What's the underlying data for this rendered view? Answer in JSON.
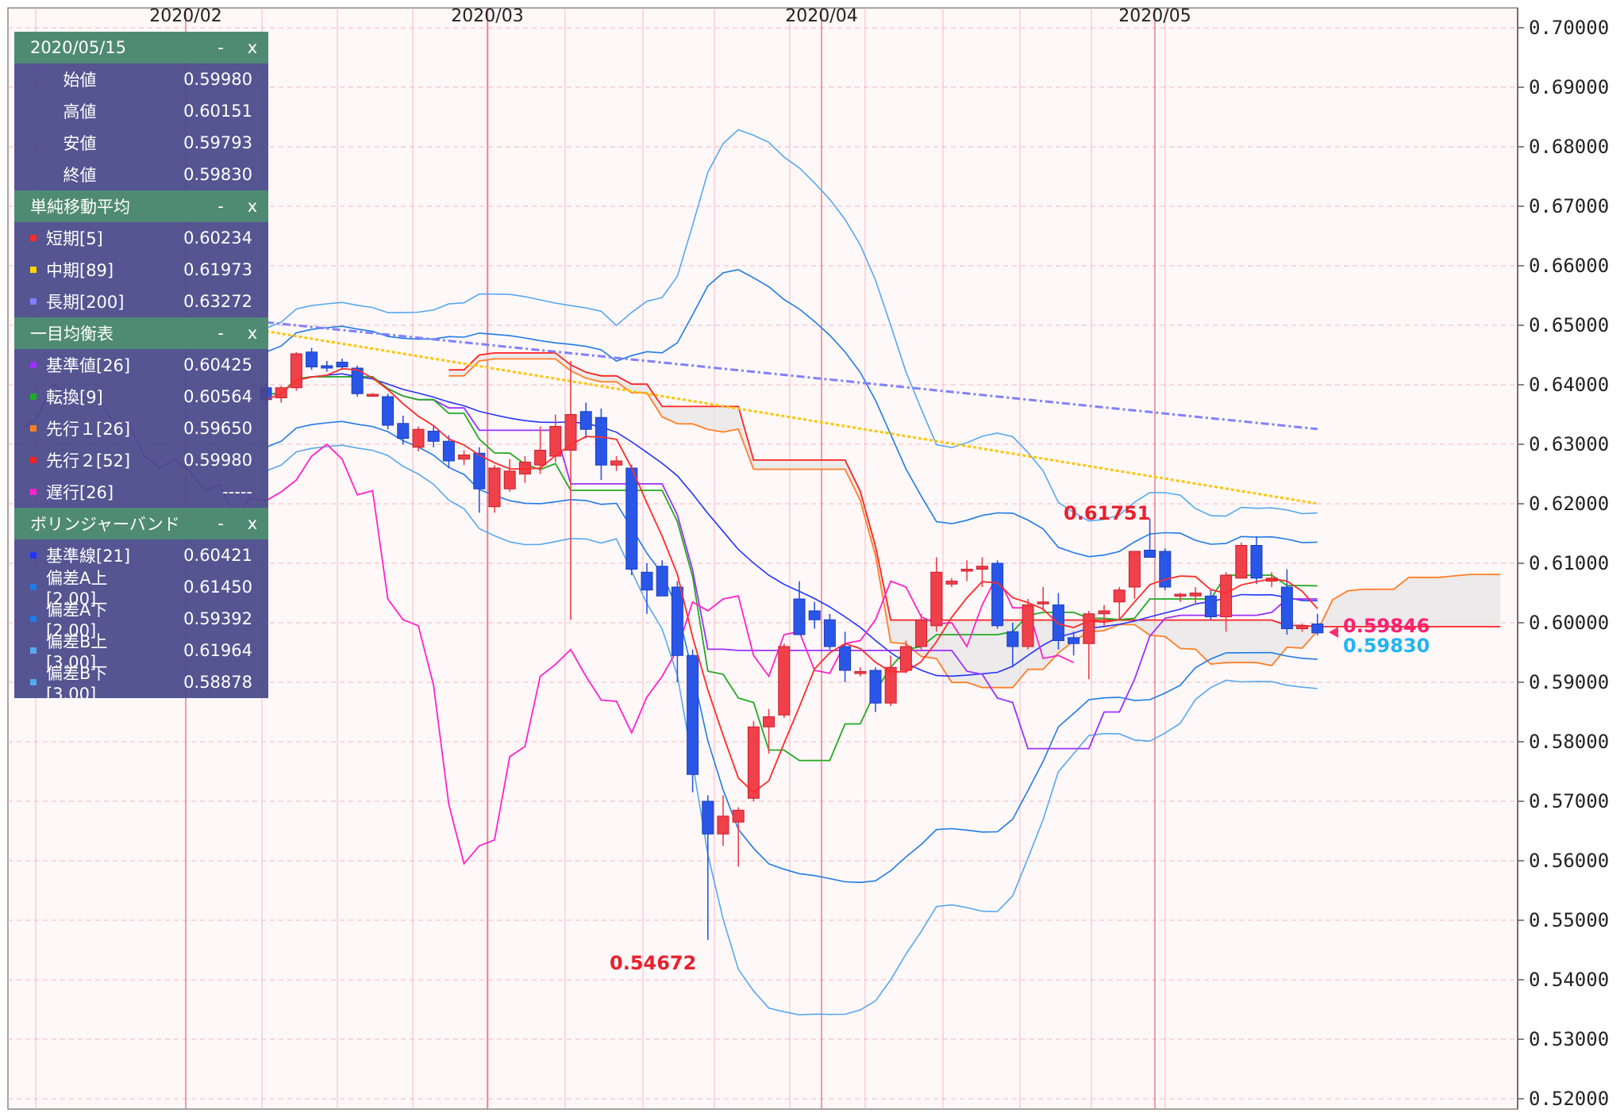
{
  "chart_data": {
    "type": "candlestick",
    "x_labels": [
      "2020/02",
      "2020/03",
      "2020/04",
      "2020/05"
    ],
    "ylim": [
      0.52,
      0.7
    ],
    "y_ticks": [
      "0.52000",
      "0.53000",
      "0.54000",
      "0.55000",
      "0.56000",
      "0.57000",
      "0.58000",
      "0.59000",
      "0.60000",
      "0.61000",
      "0.62000",
      "0.63000",
      "0.64000",
      "0.65000",
      "0.66000",
      "0.67000",
      "0.68000",
      "0.69000",
      "0.70000"
    ],
    "candles": [
      [
        0.6395,
        0.6405,
        0.6365,
        0.6375
      ],
      [
        0.6378,
        0.6398,
        0.637,
        0.6395
      ],
      [
        0.6395,
        0.6455,
        0.639,
        0.6452
      ],
      [
        0.6455,
        0.6462,
        0.6425,
        0.643
      ],
      [
        0.6432,
        0.644,
        0.6422,
        0.6428
      ],
      [
        0.6438,
        0.6444,
        0.6425,
        0.643
      ],
      [
        0.6428,
        0.6432,
        0.638,
        0.6385
      ],
      [
        0.6382,
        0.6386,
        0.638,
        0.6384
      ],
      [
        0.638,
        0.6385,
        0.6325,
        0.6332
      ],
      [
        0.6335,
        0.6348,
        0.63,
        0.631
      ],
      [
        0.6295,
        0.633,
        0.6288,
        0.6325
      ],
      [
        0.6322,
        0.633,
        0.6295,
        0.6305
      ],
      [
        0.6305,
        0.6315,
        0.626,
        0.6272
      ],
      [
        0.6275,
        0.629,
        0.6265,
        0.6282
      ],
      [
        0.6285,
        0.6295,
        0.6185,
        0.6225
      ],
      [
        0.6195,
        0.6265,
        0.6185,
        0.626
      ],
      [
        0.6225,
        0.6275,
        0.622,
        0.6255
      ],
      [
        0.625,
        0.628,
        0.6235,
        0.627
      ],
      [
        0.6265,
        0.633,
        0.625,
        0.629
      ],
      [
        0.628,
        0.635,
        0.627,
        0.633
      ],
      [
        0.629,
        0.644,
        0.6005,
        0.635
      ],
      [
        0.6355,
        0.637,
        0.631,
        0.6325
      ],
      [
        0.6345,
        0.636,
        0.624,
        0.6265
      ],
      [
        0.6265,
        0.628,
        0.6255,
        0.6272
      ],
      [
        0.626,
        0.6265,
        0.608,
        0.609
      ],
      [
        0.6085,
        0.61,
        0.6015,
        0.6055
      ],
      [
        0.6095,
        0.6105,
        0.6045,
        0.6045
      ],
      [
        0.606,
        0.607,
        0.59,
        0.5945
      ],
      [
        0.5945,
        0.5955,
        0.5715,
        0.5745
      ],
      [
        0.57,
        0.571,
        0.5467,
        0.5645
      ],
      [
        0.5645,
        0.571,
        0.5625,
        0.5675
      ],
      [
        0.5665,
        0.569,
        0.559,
        0.5685
      ],
      [
        0.5705,
        0.5835,
        0.57,
        0.5825
      ],
      [
        0.5825,
        0.5855,
        0.578,
        0.5842
      ],
      [
        0.5845,
        0.5965,
        0.584,
        0.596
      ],
      [
        0.604,
        0.607,
        0.5985,
        0.598
      ],
      [
        0.602,
        0.6035,
        0.599,
        0.6005
      ],
      [
        0.6005,
        0.6015,
        0.5955,
        0.596
      ],
      [
        0.596,
        0.5985,
        0.59,
        0.592
      ],
      [
        0.5915,
        0.5925,
        0.591,
        0.5918
      ],
      [
        0.592,
        0.5925,
        0.585,
        0.5865
      ],
      [
        0.5865,
        0.5945,
        0.586,
        0.5925
      ],
      [
        0.592,
        0.597,
        0.5915,
        0.596
      ],
      [
        0.596,
        0.6015,
        0.5955,
        0.6005
      ],
      [
        0.5995,
        0.611,
        0.5985,
        0.6085
      ],
      [
        0.6065,
        0.6075,
        0.606,
        0.607
      ],
      [
        0.609,
        0.6105,
        0.607,
        0.609
      ],
      [
        0.609,
        0.611,
        0.606,
        0.6095
      ],
      [
        0.61,
        0.6105,
        0.599,
        0.5995
      ],
      [
        0.5985,
        0.6,
        0.5925,
        0.596
      ],
      [
        0.596,
        0.604,
        0.5955,
        0.603
      ],
      [
        0.6032,
        0.606,
        0.602,
        0.6035
      ],
      [
        0.603,
        0.605,
        0.5955,
        0.597
      ],
      [
        0.5975,
        0.5985,
        0.5945,
        0.5965
      ],
      [
        0.5965,
        0.602,
        0.5905,
        0.6015
      ],
      [
        0.6015,
        0.603,
        0.5995,
        0.602
      ],
      [
        0.6035,
        0.606,
        0.6005,
        0.6055
      ],
      [
        0.606,
        0.611,
        0.604,
        0.612
      ],
      [
        0.6122,
        0.6175,
        0.611,
        0.611
      ],
      [
        0.612,
        0.6125,
        0.6055,
        0.606
      ],
      [
        0.6045,
        0.605,
        0.6035,
        0.6048
      ],
      [
        0.6045,
        0.606,
        0.603,
        0.605
      ],
      [
        0.6045,
        0.6055,
        0.6005,
        0.601
      ],
      [
        0.601,
        0.6085,
        0.5985,
        0.608
      ],
      [
        0.6075,
        0.6135,
        0.6075,
        0.613
      ],
      [
        0.613,
        0.6145,
        0.6065,
        0.6075
      ],
      [
        0.607,
        0.6085,
        0.606,
        0.6075
      ],
      [
        0.606,
        0.609,
        0.598,
        0.599
      ],
      [
        0.599,
        0.5998,
        0.5985,
        0.5995
      ],
      [
        0.5998,
        0.6015,
        0.5979,
        0.5983
      ]
    ],
    "high_label": "0.61751",
    "low_label": "0.54672",
    "current_labels": [
      "0.59846",
      "0.59830"
    ],
    "price_red": "#f0404a",
    "price_blue": "#2a56e8",
    "ichimoku_fill": "#f7b98e",
    "ichimoku_fill_neg": "#e6e6e6",
    "grid": true
  },
  "panels": {
    "ohlc": {
      "title": "2020/05/15",
      "rows": [
        {
          "label": "始値",
          "value": "0.59980"
        },
        {
          "label": "高値",
          "value": "0.60151"
        },
        {
          "label": "安値",
          "value": "0.59793"
        },
        {
          "label": "終値",
          "value": "0.59830"
        }
      ]
    },
    "sma": {
      "title": "単純移動平均",
      "rows": [
        {
          "label": "短期[5]",
          "value": "0.60234",
          "color": "#ff2b2b"
        },
        {
          "label": "中期[89]",
          "value": "0.61973",
          "color": "#ffd700"
        },
        {
          "label": "長期[200]",
          "value": "0.63272",
          "color": "#8080ff"
        }
      ]
    },
    "ichimoku": {
      "title": "一目均衡表",
      "rows": [
        {
          "label": "基準値[26]",
          "value": "0.60425",
          "color": "#9b30ff"
        },
        {
          "label": "転換[9]",
          "value": "0.60564",
          "color": "#22aa22"
        },
        {
          "label": "先行１[26]",
          "value": "0.59650",
          "color": "#ff7f27"
        },
        {
          "label": "先行２[52]",
          "value": "0.59980",
          "color": "#ff2222"
        },
        {
          "label": "遅行[26]",
          "value": "-----",
          "color": "#ff22cc"
        }
      ]
    },
    "bollinger": {
      "title": "ボリンジャーバンド",
      "rows": [
        {
          "label": "基準線[21]",
          "value": "0.60421",
          "color": "#2233ff"
        },
        {
          "label": "偏差A上[2.00]",
          "value": "0.61450",
          "color": "#1e7be8"
        },
        {
          "label": "偏差A下[2.00]",
          "value": "0.59392",
          "color": "#1e7be8"
        },
        {
          "label": "偏差B上[3.00]",
          "value": "0.61964",
          "color": "#55a8f0"
        },
        {
          "label": "偏差B下[3.00]",
          "value": "0.58878",
          "color": "#55a8f0"
        }
      ]
    },
    "btn_min": "-",
    "btn_close": "x"
  }
}
